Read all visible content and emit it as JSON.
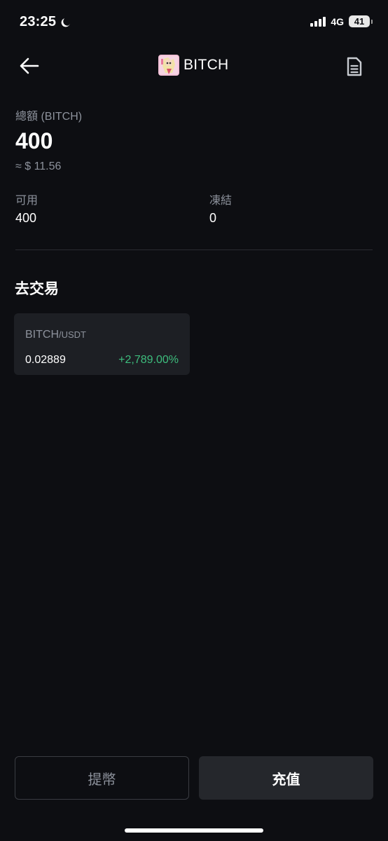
{
  "status_bar": {
    "time": "23:25",
    "network": "4G",
    "battery": "41"
  },
  "header": {
    "title": "BITCH",
    "back_icon": "arrow-left-icon",
    "doc_icon": "document-icon"
  },
  "balance": {
    "total_label": "總額 (BITCH)",
    "total_value": "400",
    "approx_value": "≈ $ 11.56",
    "available_label": "可用",
    "available_value": "400",
    "frozen_label": "凍結",
    "frozen_value": "0"
  },
  "trade": {
    "section_title": "去交易",
    "pair_base": "BITCH",
    "pair_quote": "/USDT",
    "price": "0.02889",
    "change": "+2,789.00%"
  },
  "actions": {
    "withdraw_label": "提幣",
    "deposit_label": "充值"
  },
  "colors": {
    "background": "#0d0e12",
    "card": "#1d1f24",
    "positive": "#3dbd7d",
    "muted": "#8d929c"
  }
}
